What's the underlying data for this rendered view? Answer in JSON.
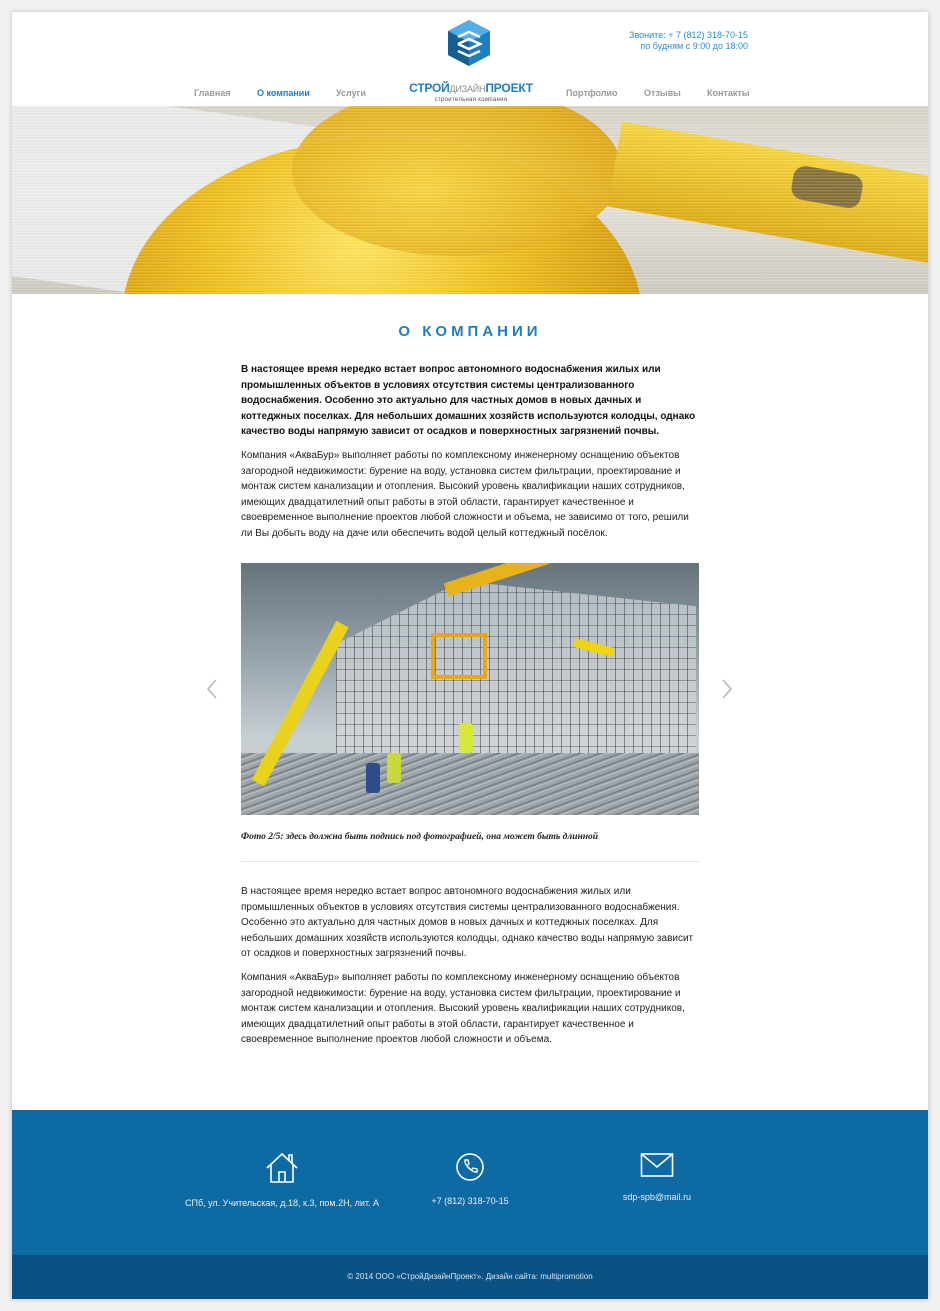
{
  "header": {
    "logo": {
      "part1": "СТРОЙ",
      "part2": "ДИЗАЙН",
      "part3": "ПРОЕКТ",
      "subtitle": "строительная компания"
    },
    "contact": {
      "phone_line": "Звоните: + 7 (812) 318-70-15",
      "hours_line": "по будням с 9:00 до 18:00"
    },
    "nav": {
      "home": "Главная",
      "about": "О компании",
      "services": "Услуги",
      "portfolio": "Портфолио",
      "reviews": "Отзывы",
      "contacts": "Контакты",
      "active": "about"
    }
  },
  "main": {
    "title": "О КОМПАНИИ",
    "intro_bold": "В настоящее время нередко встает вопрос автономного водоснабжения жилых или промышленных объектов в условиях отсутствия системы централизованного водоснабжения. Особенно это актуально для частных домов в новых дачных и коттеджных поселках. Для небольших домашних хозяйств используются колодцы, однако качество воды напрямую зависит от осадков и поверхностных загрязнений почвы.",
    "paragraph1": "Компания «АкваБур» выполняет работы по комплексному инженерному оснащению объектов загородной недвижимости: бурение на воду, установка систем фильтрации, проектирование и монтаж систем канализации и отопления. Высокий уровень квалификации наших сотрудников, имеющих двадцатилетний опыт работы в этой области, гарантирует качественное и своевременное выполнение проектов любой сложности и объема, не зависимо от того, решили ли Вы добыть воду на даче или обеспечить водой целый коттеджный посёлок.",
    "gallery": {
      "current": 2,
      "total": 5,
      "caption": "Фото 2/5: здесь должна быть подпись под фотографией, она может быть длинной"
    },
    "paragraph2": "В настоящее время нередко встает вопрос автономного водоснабжения жилых или промышленных объектов в условиях отсутствия системы централизованного водоснабжения. Особенно это актуально для частных домов в новых дачных и коттеджных поселках. Для небольших домашних хозяйств используются колодцы, однако качество воды напрямую зависит от осадков и поверхностных загрязнений почвы.",
    "paragraph3": "Компания «АкваБур» выполняет работы по комплексному инженерному оснащению объектов загородной недвижимости: бурение на воду, установка систем фильтрации, проектирование и монтаж систем канализации и отопления. Высокий уровень квалификации наших сотрудников, имеющих двадцатилетний опыт работы в этой области, гарантирует качественное и своевременное выполнение проектов любой сложности и объема."
  },
  "footer": {
    "address": "СПб, ул. Учительская, д.18, к.3, пом.2Н, лит. А",
    "phone": "+7 (812) 318-70-15",
    "email": "sdp-spb@mail.ru",
    "copyright": "© 2014 ООО «СтройДизайнПроект». Дизайн сайта: multipromotion"
  },
  "icons": {
    "address": "home-icon",
    "phone": "phone-icon",
    "email": "envelope-icon",
    "prev": "chevron-left-icon",
    "next": "chevron-right-icon"
  },
  "colors": {
    "accent": "#1e7fc0",
    "footer": "#0e6aa3",
    "footer_bottom": "#0a5283"
  }
}
